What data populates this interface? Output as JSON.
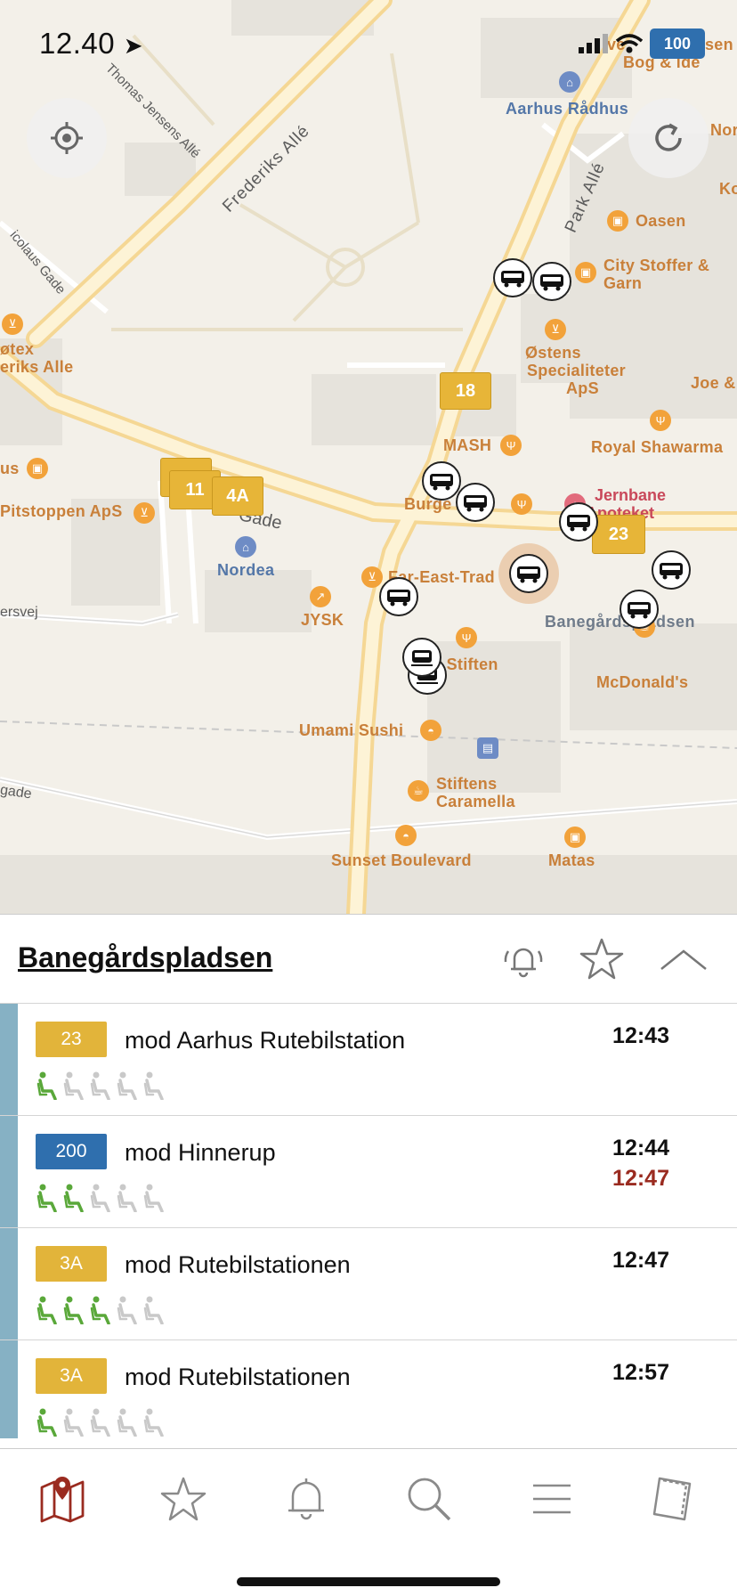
{
  "status_bar": {
    "time": "12.40",
    "carrier_badge": "100"
  },
  "map": {
    "roads": [
      "Frederiks Allé",
      "Park Allé",
      "Thomas Jensens Allé",
      "icolaus Gade",
      "ersvej",
      "gade",
      "Gade"
    ],
    "pois": {
      "radhus": "Aarhus Rådhus",
      "oasen": "Oasen",
      "city_stoffer": "City Stoffer &",
      "city_stoffer2": "Garn",
      "ostens": "Østens",
      "ostens2": "Specialiteter",
      "ostens3": "ApS",
      "joe": "Joe &",
      "mash": "MASH",
      "shawarma": "Royal Shawarma",
      "jernbane": "Jernbane",
      "apoteket": "Apoteket",
      "burger": "Burge",
      "burger_tail": "g",
      "far_east": "Far-East-Trad",
      "nordea": "Nordea",
      "jysk": "JYSK",
      "banegard": "Banegårdspladsen",
      "mcdonalds": "McDonald's",
      "stiften": "e Stiften",
      "umami": "Umami Sushi",
      "caramella": "Stiftens",
      "caramella2": "Caramella",
      "sunset": "Sunset Boulevard",
      "matas": "Matas",
      "pitstop": "Pitstoppen ApS",
      "fotex": "øtex",
      "fotex2": "eriks Alle",
      "us": "us",
      "nor": "Nor",
      "ko": "Ko",
      "bog": "Bog & idé",
      "sen": "sen",
      "ve": "ve"
    },
    "route_badges": [
      "18",
      "11",
      "4A",
      "23",
      "B"
    ]
  },
  "stop": {
    "name": "Banegårdspladsen",
    "departures": [
      {
        "line": "23",
        "color": "#e2b43a",
        "destination": "mod Aarhus Rutebilstation",
        "time": "12:43",
        "delayed_time": "",
        "occupancy": 1
      },
      {
        "line": "200",
        "color": "#2f6fae",
        "destination": "mod Hinnerup",
        "time": "12:44",
        "delayed_time": "12:47",
        "occupancy": 2
      },
      {
        "line": "3A",
        "color": "#e2b43a",
        "destination": "mod Rutebilstationen",
        "time": "12:47",
        "delayed_time": "",
        "occupancy": 3
      },
      {
        "line": "3A",
        "color": "#e2b43a",
        "destination": "mod Rutebilstationen",
        "time": "12:57",
        "delayed_time": "",
        "occupancy": 1
      }
    ]
  },
  "tabs": [
    "map-pin-icon",
    "star-icon",
    "bell-icon",
    "search-icon",
    "menu-icon",
    "ticket-icon"
  ],
  "colors": {
    "accent": "#9a2b20",
    "stripe": "#86b1c4",
    "seat_on": "#5aa83a",
    "seat_off": "#c9c9c9"
  }
}
